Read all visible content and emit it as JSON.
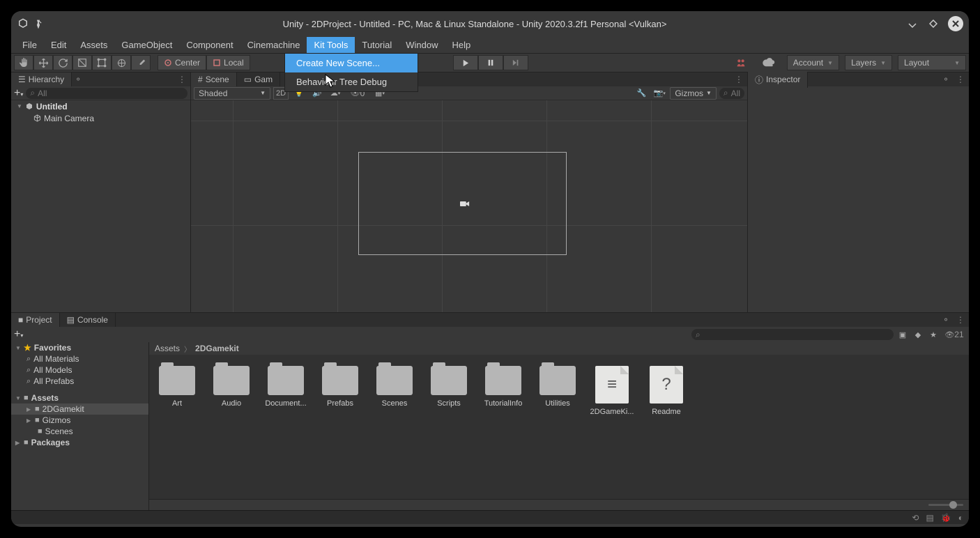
{
  "title": "Unity - 2DProject - Untitled - PC, Mac & Linux Standalone - Unity 2020.3.2f1 Personal <Vulkan>",
  "menubar": [
    "File",
    "Edit",
    "Assets",
    "GameObject",
    "Component",
    "Cinemachine",
    "Kit Tools",
    "Tutorial",
    "Window",
    "Help"
  ],
  "menubar_active": "Kit Tools",
  "dropdown": [
    "Create New Scene...",
    "Behaviour Tree Debug"
  ],
  "dropdown_hl": "Create New Scene...",
  "toolbar": {
    "center_label": "Center",
    "local_label": "Local",
    "account": "Account",
    "layers": "Layers",
    "layout": "Layout"
  },
  "panes": {
    "hierarchy": "Hierarchy",
    "scene": "Scene",
    "game": "Gam",
    "inspector": "Inspector",
    "project": "Project",
    "console": "Console"
  },
  "hierarchy": {
    "search_placeholder": "All",
    "root": "Untitled",
    "children": [
      "Main Camera"
    ]
  },
  "scene": {
    "shading": "Shaded",
    "mode2d": "2D",
    "gizmos": "Gizmos",
    "search_placeholder": "All",
    "vis_count": "0"
  },
  "project": {
    "search_placeholder": "",
    "hidden_count": "21",
    "favorites_label": "Favorites",
    "favorites": [
      "All Materials",
      "All Models",
      "All Prefabs"
    ],
    "assets_label": "Assets",
    "assets_tree": {
      "root_children": [
        "2DGamekit",
        "Gizmos",
        "Scenes"
      ],
      "selected": "2DGamekit"
    },
    "packages_label": "Packages",
    "breadcrumb": [
      "Assets",
      "2DGamekit"
    ],
    "grid": [
      {
        "type": "folder",
        "label": "Art"
      },
      {
        "type": "folder",
        "label": "Audio"
      },
      {
        "type": "folder",
        "label": "Document..."
      },
      {
        "type": "folder",
        "label": "Prefabs"
      },
      {
        "type": "folder",
        "label": "Scenes"
      },
      {
        "type": "folder",
        "label": "Scripts"
      },
      {
        "type": "folder",
        "label": "TutorialInfo"
      },
      {
        "type": "folder",
        "label": "Utilities"
      },
      {
        "type": "file",
        "label": "2DGameKi...",
        "glyph": "≡"
      },
      {
        "type": "file",
        "label": "Readme",
        "glyph": "?"
      }
    ]
  }
}
